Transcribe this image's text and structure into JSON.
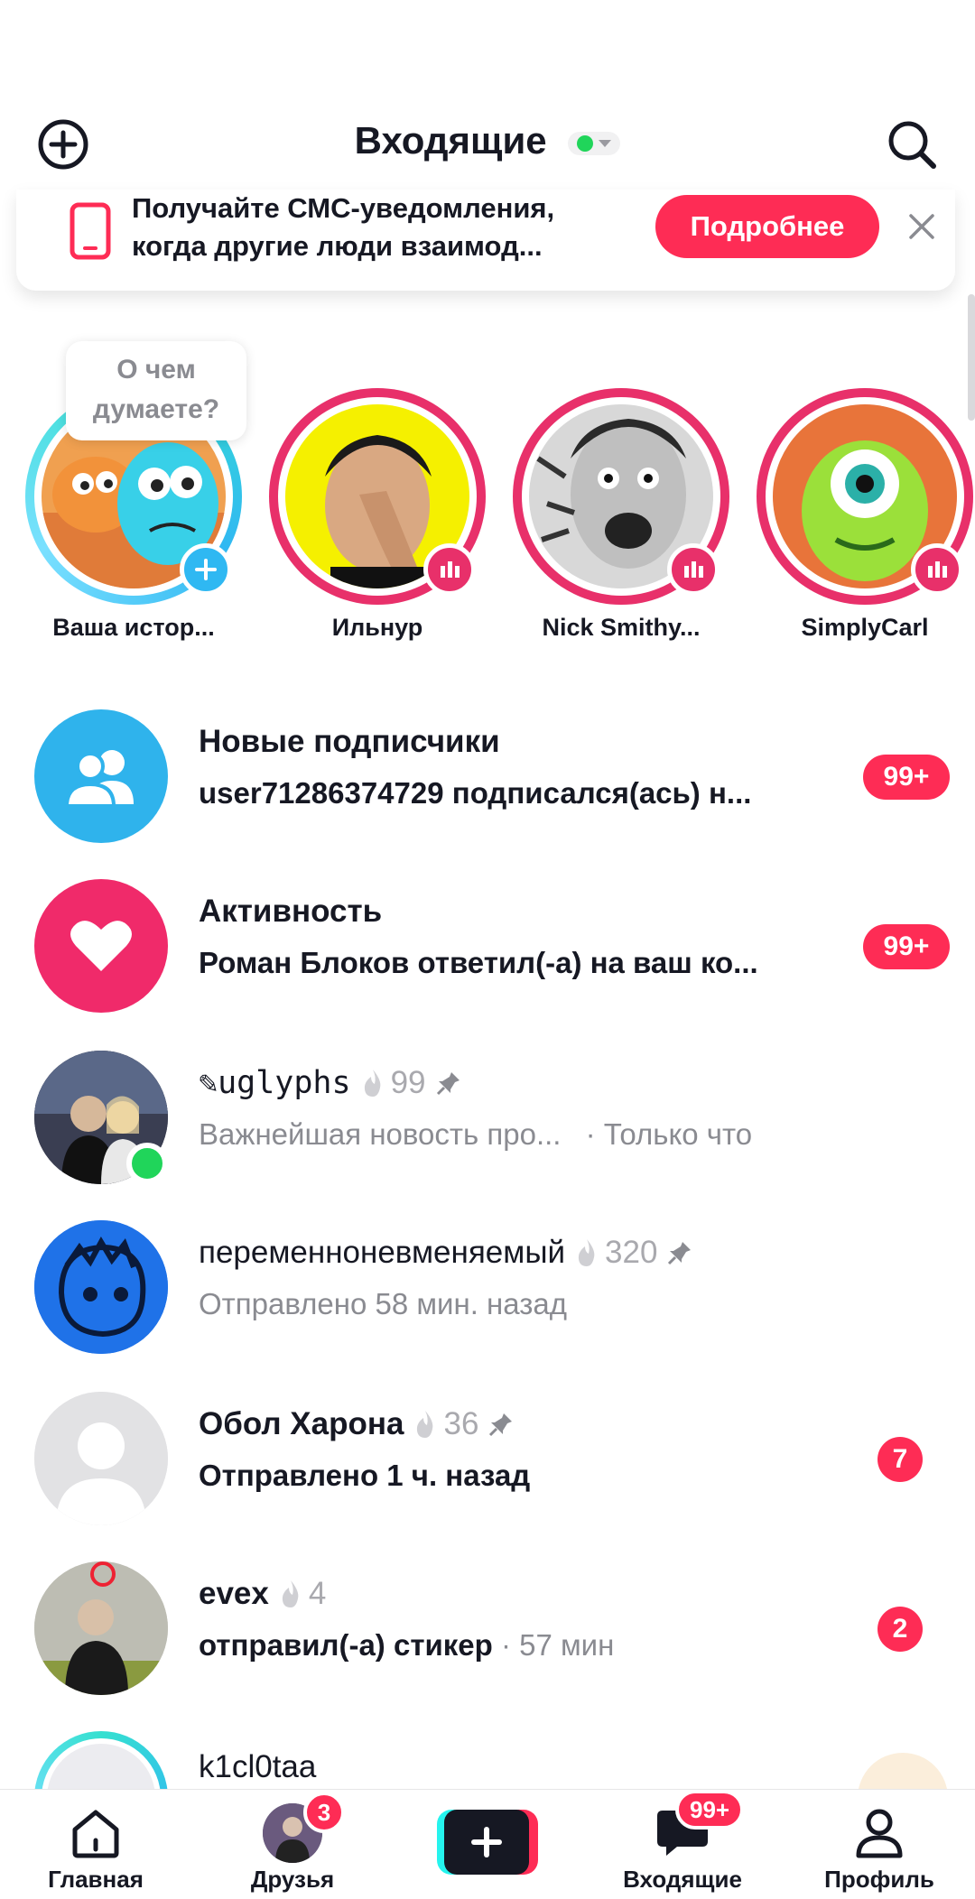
{
  "header": {
    "title": "Входящие",
    "add_icon": "plus-circle-icon",
    "search_icon": "search-icon"
  },
  "banner": {
    "line1": "Получайте СМС-уведомления,",
    "line2": "когда другие люди взаимод...",
    "button": "Подробнее"
  },
  "stories": {
    "bubble": "О чем думаете?",
    "items": [
      {
        "name": "Ваша истор..."
      },
      {
        "name": "Ильнур"
      },
      {
        "name": "Nick Smithy..."
      },
      {
        "name": "SimplyCarl"
      }
    ]
  },
  "rows": [
    {
      "title": "Новые подписчики",
      "subtitle": "user71286374729 подписался(ась) н...",
      "badge": "99+"
    },
    {
      "title": "Активность",
      "subtitle": "Роман Блоков ответил(-а) на ваш ко...",
      "badge": "99+"
    },
    {
      "title": "✎uglyphs",
      "streak": "99",
      "subtitle": "Важнейшая новость про...",
      "time": " · Только что"
    },
    {
      "title": "переменноневменяемый",
      "streak": "320",
      "subtitle": "Отправлено 58 мин. назад"
    },
    {
      "title": "Обол Харона",
      "streak": "36",
      "subtitle": "Отправлено 1 ч. назад",
      "badge": "7"
    },
    {
      "title": "evex",
      "streak": "4",
      "subtitle": "отправил(-а) стикер",
      "time": " · 57 мин",
      "badge": "2"
    },
    {
      "title": "k1cl0taa"
    }
  ],
  "nav": {
    "home": "Главная",
    "friends": "Друзья",
    "friends_badge": "3",
    "inbox": "Входящие",
    "inbox_badge": "99+",
    "profile": "Профиль"
  },
  "colors": {
    "accent": "#fe2c55",
    "story_ring": "#e8306a",
    "online": "#20d55a",
    "followers_icon_bg": "#2fb3ec"
  }
}
